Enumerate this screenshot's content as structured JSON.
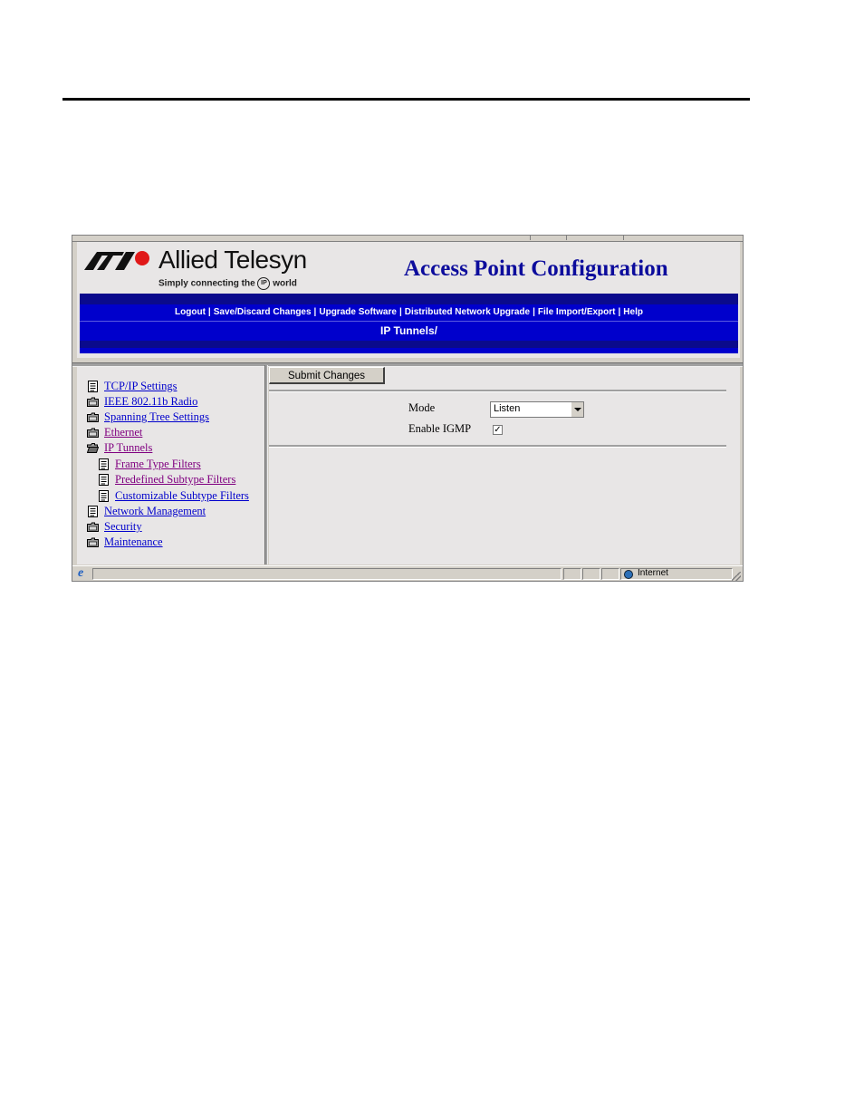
{
  "header": {
    "logo_name": "Allied Telesyn",
    "logo_tagline_pre": "Simply connecting the",
    "logo_tagline_ip": "IP",
    "logo_tagline_post": "world",
    "app_title": "Access Point Configuration"
  },
  "nav": {
    "items": [
      "Logout",
      "Save/Discard Changes",
      "Upgrade Software",
      "Distributed Network Upgrade",
      "File Import/Export",
      "Help"
    ],
    "separator": "|"
  },
  "breadcrumb": "IP Tunnels/",
  "sidebar": {
    "items": [
      {
        "label": "TCP/IP Settings",
        "icon": "page-icon",
        "level": 0,
        "visited": false
      },
      {
        "label": "IEEE 802.11b Radio",
        "icon": "folder-closed-icon",
        "level": 0,
        "visited": false
      },
      {
        "label": "Spanning Tree Settings",
        "icon": "folder-closed-icon",
        "level": 0,
        "visited": false
      },
      {
        "label": "Ethernet",
        "icon": "folder-closed-icon",
        "level": 0,
        "visited": true
      },
      {
        "label": "IP Tunnels",
        "icon": "folder-open-icon",
        "level": 0,
        "visited": true
      },
      {
        "label": "Frame Type Filters",
        "icon": "page-icon",
        "level": 1,
        "visited": true
      },
      {
        "label": "Predefined Subtype Filters",
        "icon": "page-icon",
        "level": 1,
        "visited": true
      },
      {
        "label": "Customizable Subtype Filters",
        "icon": "page-icon",
        "level": 1,
        "visited": false
      },
      {
        "label": "Network Management",
        "icon": "page-icon",
        "level": 0,
        "visited": false
      },
      {
        "label": "Security",
        "icon": "folder-closed-icon",
        "level": 0,
        "visited": false
      },
      {
        "label": "Maintenance",
        "icon": "folder-closed-icon",
        "level": 0,
        "visited": false
      }
    ]
  },
  "form": {
    "submit_label": "Submit Changes",
    "mode_label": "Mode",
    "mode_value": "Listen",
    "igmp_label": "Enable IGMP",
    "igmp_checked": true
  },
  "statusbar": {
    "zone": "Internet"
  },
  "colors": {
    "nav_blue": "#0000cc",
    "band_dark": "#0a0a8c",
    "title_blue": "#0c0c9c",
    "link": "#0000cc",
    "visited_link": "#800080"
  }
}
